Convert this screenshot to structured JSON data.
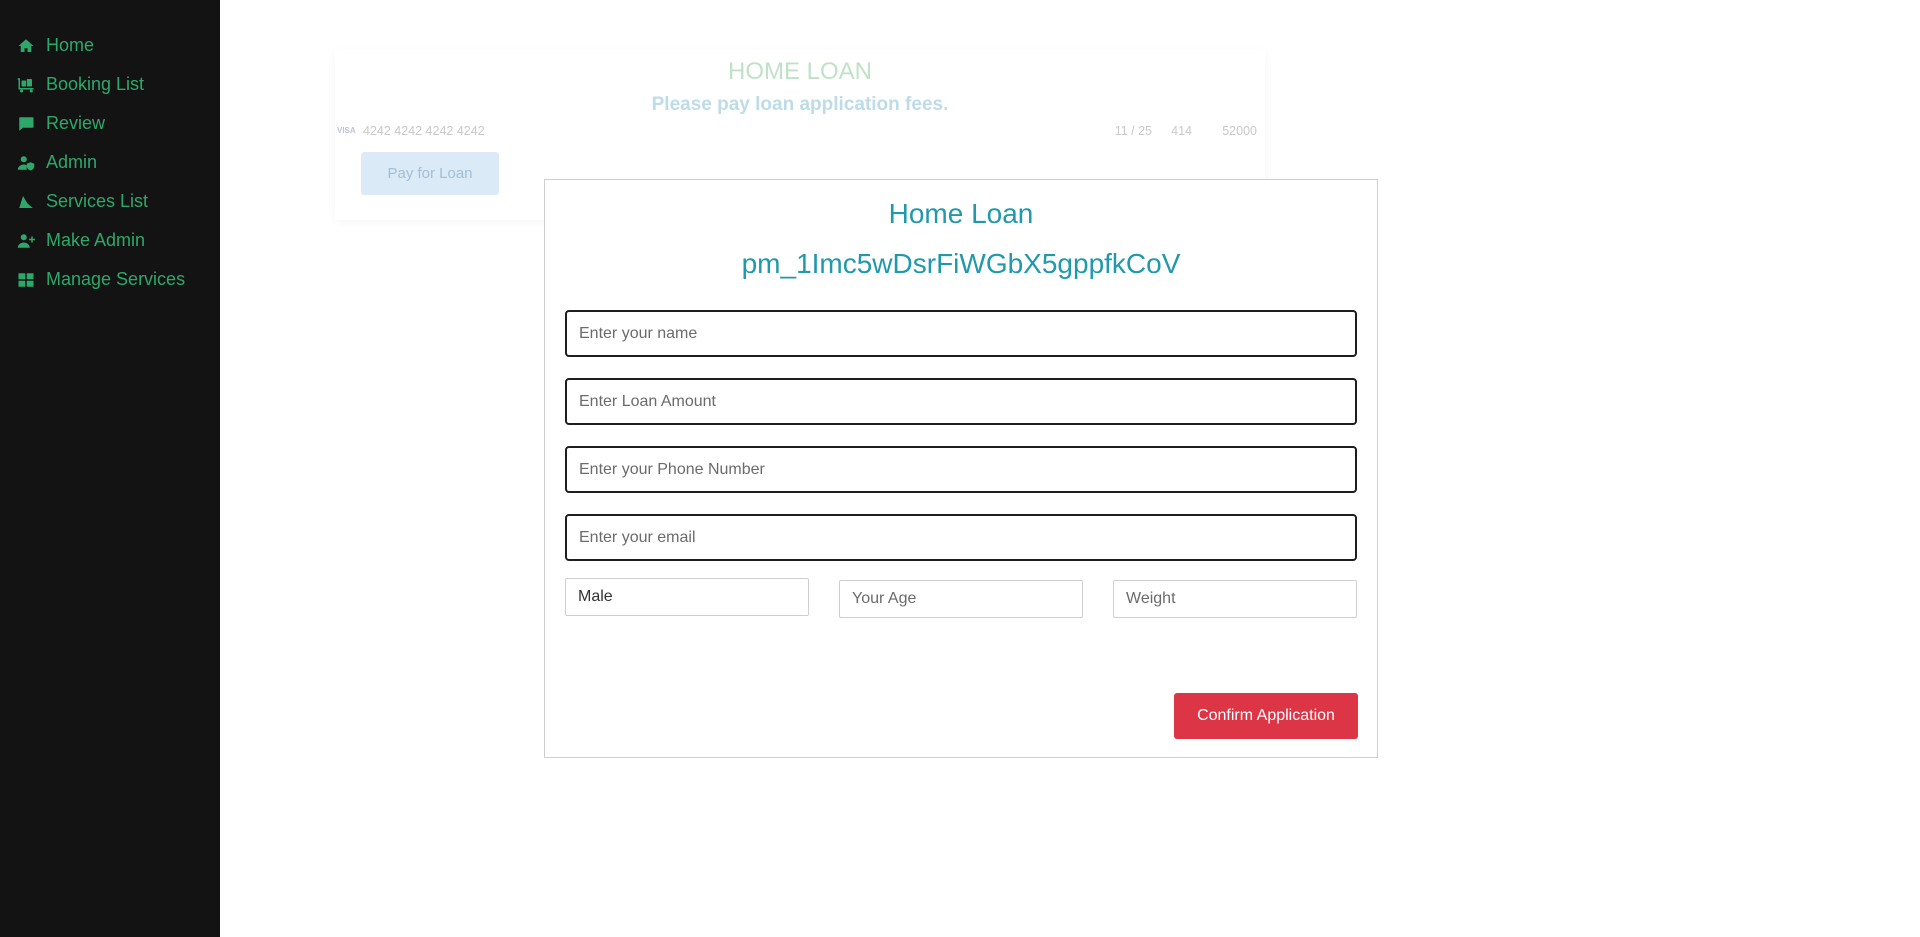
{
  "sidebar": {
    "items": [
      {
        "label": "Home",
        "icon": "home-icon"
      },
      {
        "label": "Booking List",
        "icon": "luggage-cart-icon"
      },
      {
        "label": "Review",
        "icon": "comment-icon"
      },
      {
        "label": "Admin",
        "icon": "user-shield-icon"
      },
      {
        "label": "Services List",
        "icon": "ship-icon"
      },
      {
        "label": "Make Admin",
        "icon": "user-plus-icon"
      },
      {
        "label": "Manage Services",
        "icon": "grid-icon"
      }
    ],
    "color": "#2ea86a",
    "background": "#131313"
  },
  "background_card": {
    "title": "HOME LOAN",
    "subtitle": "Please pay loan application fees.",
    "card_brand": "VISA",
    "card_number": "4242 4242 4242 4242",
    "expiry": "11 / 25",
    "cvc": "414",
    "zip": "52000",
    "pay_button": "Pay for Loan"
  },
  "modal": {
    "title": "Home Loan",
    "payment_id": "pm_1Imc5wDsrFiWGbX5gppfkCoV",
    "name_placeholder": "Enter your name",
    "amount_placeholder": "Enter Loan Amount",
    "phone_placeholder": "Enter your Phone Number",
    "email_placeholder": "Enter your email",
    "gender_value": "Male",
    "age_placeholder": "Your Age",
    "weight_placeholder": "Weight",
    "confirm_label": "Confirm Application",
    "accent": "#2199ad",
    "confirm_color": "#dc3545"
  }
}
